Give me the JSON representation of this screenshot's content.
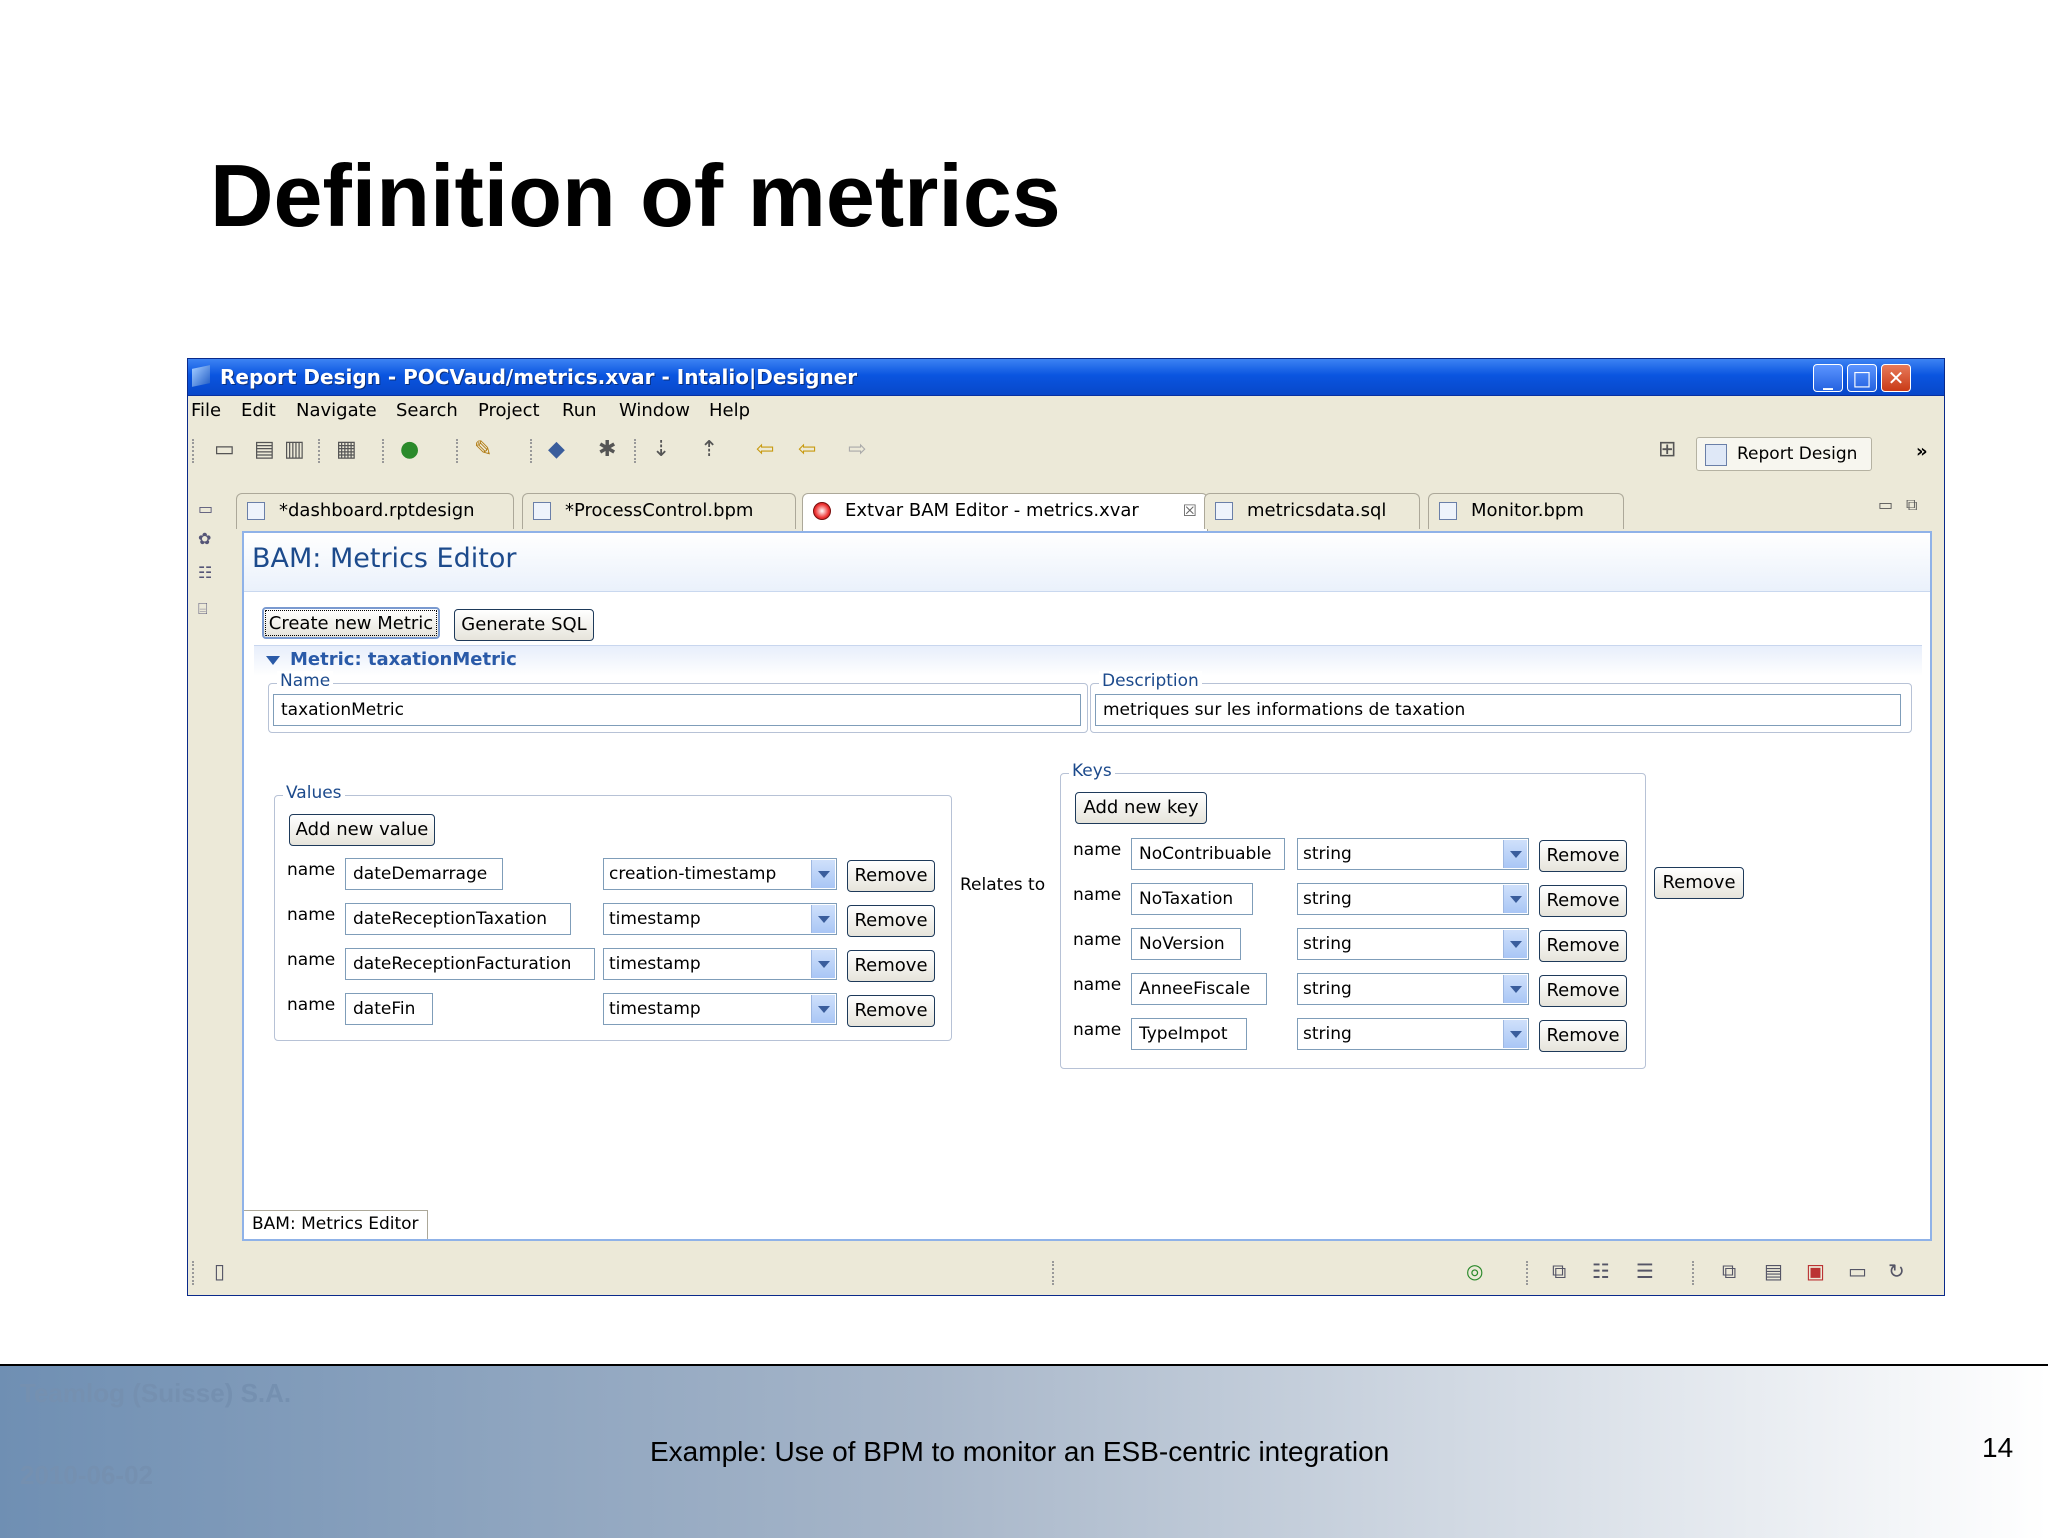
{
  "slide": {
    "title": "Definition of metrics",
    "footer": {
      "company": "Teamlog (Suisse) S.A.",
      "date": "2010-06-02",
      "caption": "Example: Use of BPM to monitor an ESB-centric integration",
      "page": "14"
    }
  },
  "window": {
    "title": "Report Design - POCVaud/metrics.xvar - Intalio|Designer",
    "controls": {
      "minimize": "_",
      "maximize": "□",
      "close": "✕"
    }
  },
  "menu": [
    "File",
    "Edit",
    "Navigate",
    "Search",
    "Project",
    "Run",
    "Window",
    "Help"
  ],
  "perspective": {
    "label": "Report Design",
    "more": "»"
  },
  "tabs": [
    {
      "label": "*dashboard.rptdesign"
    },
    {
      "label": "*ProcessControl.bpm"
    },
    {
      "label": "Extvar BAM Editor - metrics.xvar",
      "close": "☒"
    },
    {
      "label": "metricsdata.sql"
    },
    {
      "label": "Monitor.bpm"
    }
  ],
  "editor": {
    "title": "BAM: Metrics Editor",
    "create_button": "Create new Metric",
    "generate_button": "Generate SQL",
    "section_title": "Metric: taxationMetric",
    "name_label": "Name",
    "name_value": "taxationMetric",
    "description_label": "Description",
    "description_value": "metriques sur les informations de taxation",
    "values_label": "Values",
    "add_value_button": "Add new value",
    "keys_label": "Keys",
    "add_key_button": "Add new key",
    "row_label": "name",
    "remove_label": "Remove",
    "relates_to": "Relates to",
    "values": [
      {
        "name": "dateDemarrage",
        "type": "creation-timestamp"
      },
      {
        "name": "dateReceptionTaxation",
        "type": "timestamp"
      },
      {
        "name": "dateReceptionFacturation",
        "type": "timestamp"
      },
      {
        "name": "dateFin",
        "type": "timestamp"
      }
    ],
    "keys": [
      {
        "name": "NoContribuable",
        "type": "string"
      },
      {
        "name": "NoTaxation",
        "type": "string"
      },
      {
        "name": "NoVersion",
        "type": "string"
      },
      {
        "name": "AnneeFiscale",
        "type": "string"
      },
      {
        "name": "TypeImpot",
        "type": "string"
      }
    ],
    "bottom_tab": "BAM: Metrics Editor"
  }
}
